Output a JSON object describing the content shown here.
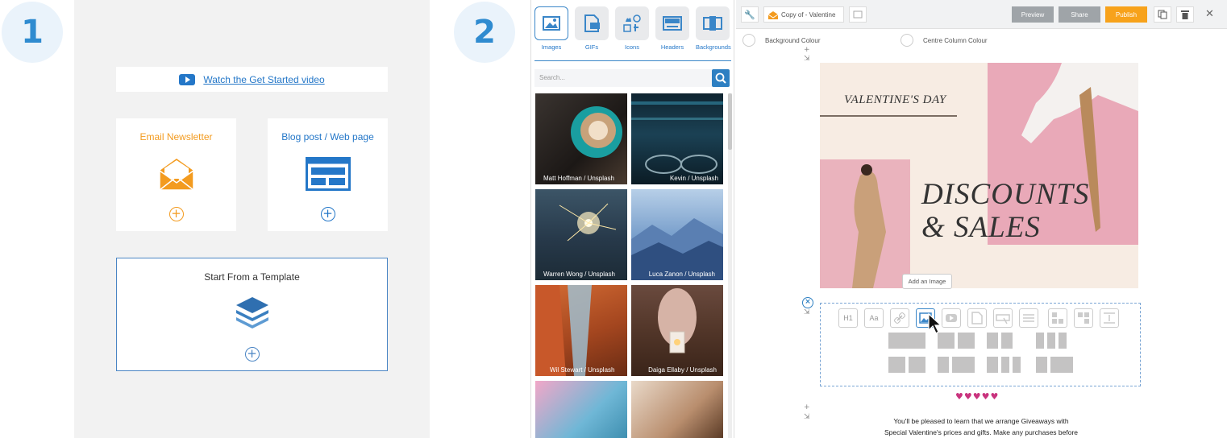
{
  "steps": {
    "one": "1",
    "two": "2"
  },
  "start": {
    "video_link": "Watch the Get Started video",
    "email_newsletter": "Email Newsletter",
    "blog_post": "Blog post / Web page",
    "template": "Start From a Template",
    "accent_orange": "#f39b1f",
    "accent_blue": "#2477c8"
  },
  "library": {
    "tabs": [
      {
        "label": "Images",
        "icon": "image-icon",
        "active": true
      },
      {
        "label": "GIFs",
        "icon": "gif-icon",
        "active": false
      },
      {
        "label": "Icons",
        "icon": "icons-icon",
        "active": false
      },
      {
        "label": "Headers",
        "icon": "header-icon",
        "active": false
      },
      {
        "label": "Backgrounds",
        "icon": "background-icon",
        "active": false
      }
    ],
    "search_placeholder": "Search...",
    "photos": [
      {
        "caption": "Matt Hoffman / Unsplash"
      },
      {
        "caption": "Kevin / Unsplash"
      },
      {
        "caption": "Warren Wong / Unsplash"
      },
      {
        "caption": "Luca Zanon / Unsplash"
      },
      {
        "caption": "Wil Stewart / Unsplash"
      },
      {
        "caption": "Daiga Ellaby / Unsplash"
      },
      {
        "caption": ""
      },
      {
        "caption": ""
      }
    ]
  },
  "editor": {
    "doc_title": "Copy of - Valentine",
    "preview": "Preview",
    "share": "Share",
    "publish": "Publish",
    "background_colour": "Background Colour",
    "centre_column_colour": "Centre Column Colour",
    "hero_title_small": "VALENTINE'S DAY",
    "hero_title_line1": "DISCOUNTS",
    "hero_title_line2": "& SALES",
    "tooltip": "Add an Image",
    "block_h1": "H1",
    "block_text": "Aa",
    "hearts": "♥♥♥♥♥",
    "body_line1": "You'll be pleased to learn that we arrange Giveaways with",
    "body_line2": "Special Valentine's prices and gifts. Make any purchases before",
    "colors": {
      "publish": "#f7a21b",
      "preview": "#9fa4a8",
      "share": "#9fa4a8",
      "heart": "#c9337e"
    }
  }
}
